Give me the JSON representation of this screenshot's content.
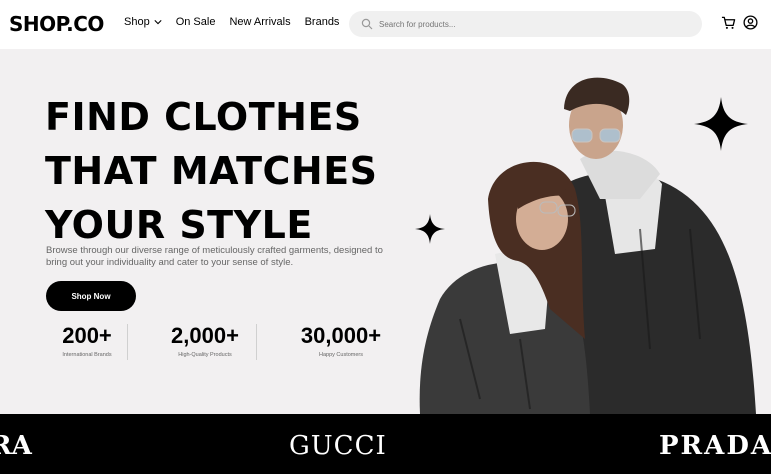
{
  "nav": {
    "logo": "SHOP.CO",
    "menu": [
      "Shop",
      "On Sale",
      "New Arrivals",
      "Brands"
    ],
    "search_placeholder": "Search for products..."
  },
  "hero": {
    "headline": [
      "FIND CLOTHES",
      "THAT MATCHES",
      "YOUR STYLE"
    ],
    "subtext": "Browse through our diverse range of meticulously crafted garments, designed to bring out your individuality and cater to your sense of style.",
    "cta_label": "Shop Now",
    "stats": [
      {
        "value": "200+",
        "label": "International Brands"
      },
      {
        "value": "2,000+",
        "label": "High-Quality Products"
      },
      {
        "value": "30,000+",
        "label": "Happy Customers"
      }
    ]
  },
  "brands": {
    "left_partial": "RA",
    "items": [
      "GUCCI",
      "PRADA"
    ]
  },
  "colors": {
    "hero_bg": "#f2f0f1",
    "primary": "#000000",
    "muted_text": "#666666"
  }
}
